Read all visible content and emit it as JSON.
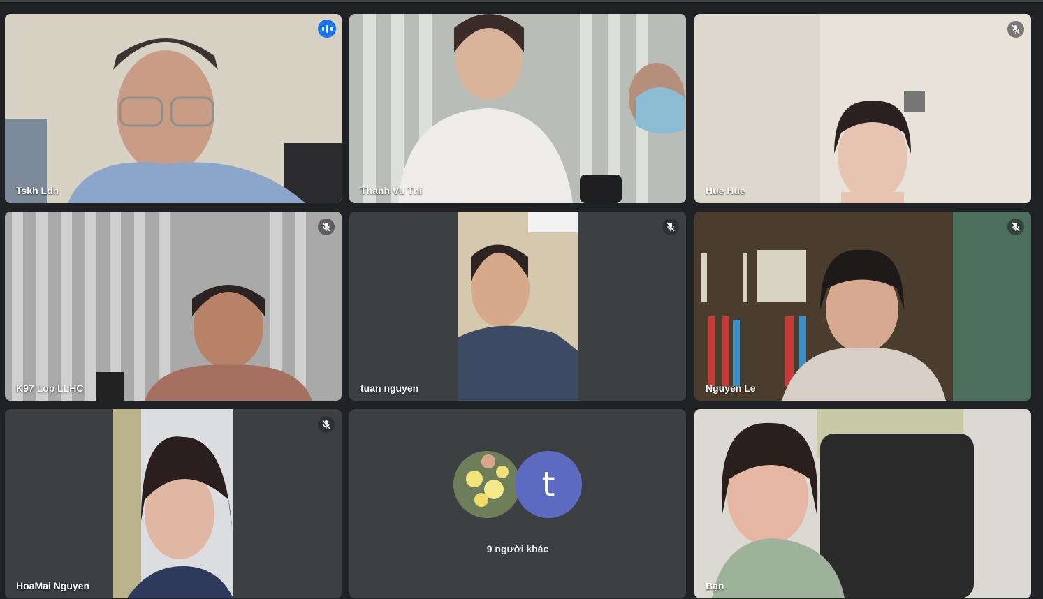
{
  "participants": [
    {
      "name": "Tskh Ldh",
      "speaking": true
    },
    {
      "name": "Thanh Vu Thi",
      "muted": false
    },
    {
      "name": "Hue Hue",
      "muted": true
    },
    {
      "name": "K97 Lop LLHC",
      "muted": true
    },
    {
      "name": "tuan nguyen",
      "muted": true
    },
    {
      "name": "Nguyen Le",
      "muted": true
    },
    {
      "name": "HoaMai Nguyen",
      "muted": true
    },
    {
      "name": "Bạn",
      "muted": false
    }
  ],
  "others": {
    "label": "9 người khác",
    "avatar_letter": "t",
    "avatar_color": "#5c6bc0"
  },
  "colors": {
    "background": "#202124",
    "tile": "#3c4043",
    "active_border": "#8ab4f8",
    "speaking_badge": "#1a73e8"
  },
  "icons": [
    "audio-wave-icon",
    "mic-off-icon"
  ]
}
